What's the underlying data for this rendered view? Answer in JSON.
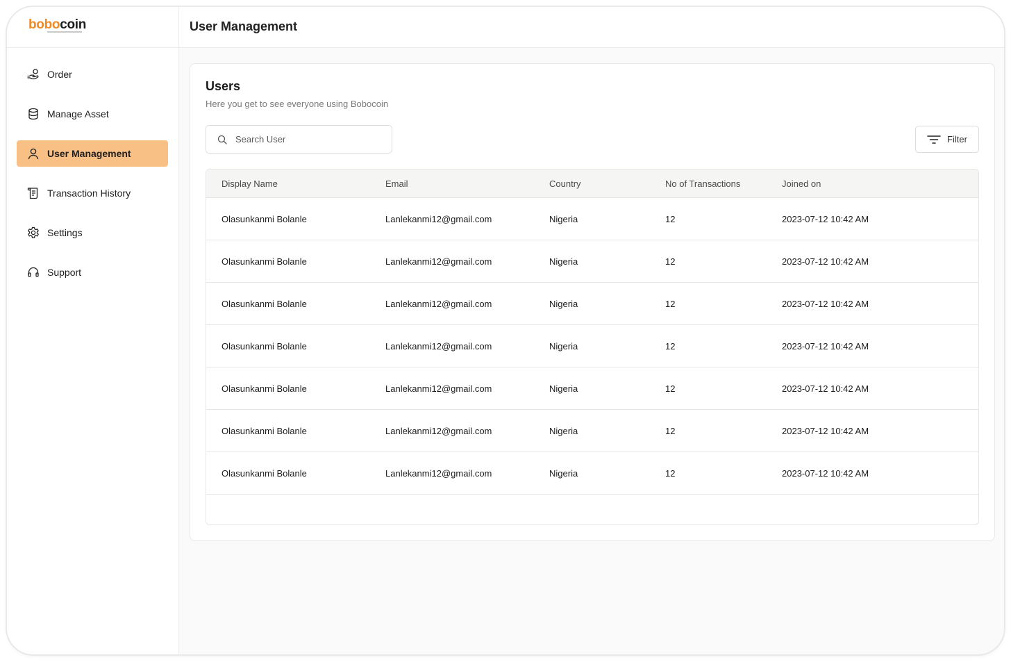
{
  "brand": {
    "name_part1": "bobo",
    "name_part2": "coin",
    "accent": "#f08a24"
  },
  "sidebar": {
    "items": [
      {
        "label": "Order",
        "icon": "hand-coin-icon",
        "active": false
      },
      {
        "label": "Manage Asset",
        "icon": "database-icon",
        "active": false
      },
      {
        "label": "User Management",
        "icon": "user-icon",
        "active": true
      },
      {
        "label": "Transaction History",
        "icon": "receipt-icon",
        "active": false
      },
      {
        "label": "Settings",
        "icon": "gear-icon",
        "active": false
      },
      {
        "label": "Support",
        "icon": "headset-icon",
        "active": false
      }
    ],
    "active_color": "#f9c086"
  },
  "header": {
    "title": "User Management"
  },
  "users_card": {
    "title": "Users",
    "subtitle": "Here you get to see everyone using Bobocoin",
    "search": {
      "placeholder": "Search User",
      "value": ""
    },
    "filter_label": "Filter"
  },
  "table": {
    "columns": [
      "Display Name",
      "Email",
      "Country",
      "No of Transactions",
      "Joined on"
    ],
    "rows": [
      [
        "Olasunkanmi Bolanle",
        "Lanlekanmi12@gmail.com",
        "Nigeria",
        "12",
        "2023-07-12 10:42 AM"
      ],
      [
        "Olasunkanmi Bolanle",
        "Lanlekanmi12@gmail.com",
        "Nigeria",
        "12",
        "2023-07-12 10:42 AM"
      ],
      [
        "Olasunkanmi Bolanle",
        "Lanlekanmi12@gmail.com",
        "Nigeria",
        "12",
        "2023-07-12 10:42 AM"
      ],
      [
        "Olasunkanmi Bolanle",
        "Lanlekanmi12@gmail.com",
        "Nigeria",
        "12",
        "2023-07-12 10:42 AM"
      ],
      [
        "Olasunkanmi Bolanle",
        "Lanlekanmi12@gmail.com",
        "Nigeria",
        "12",
        "2023-07-12 10:42 AM"
      ],
      [
        "Olasunkanmi Bolanle",
        "Lanlekanmi12@gmail.com",
        "Nigeria",
        "12",
        "2023-07-12 10:42 AM"
      ],
      [
        "Olasunkanmi Bolanle",
        "Lanlekanmi12@gmail.com",
        "Nigeria",
        "12",
        "2023-07-12 10:42 AM"
      ]
    ]
  }
}
